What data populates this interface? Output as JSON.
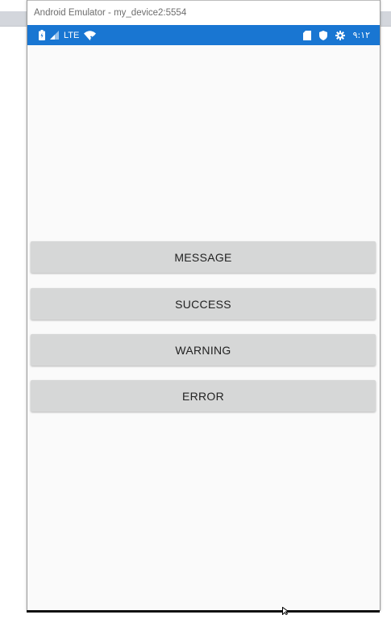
{
  "window": {
    "title": "Android Emulator - my_device2:5554"
  },
  "status_bar": {
    "network_label": "LTE",
    "clock": "٩:١٢",
    "color": "#1976d2",
    "left_icons": [
      "battery-icon",
      "signal-icon",
      "wifi-off-icon"
    ],
    "right_icons": [
      "sd-card-icon",
      "shield-icon",
      "gear-icon"
    ]
  },
  "buttons": {
    "message": "MESSAGE",
    "success": "SUCCESS",
    "warning": "WARNING",
    "error": "ERROR"
  },
  "colors": {
    "button_bg": "#d6d7d7",
    "screen_bg": "#fafafa"
  }
}
